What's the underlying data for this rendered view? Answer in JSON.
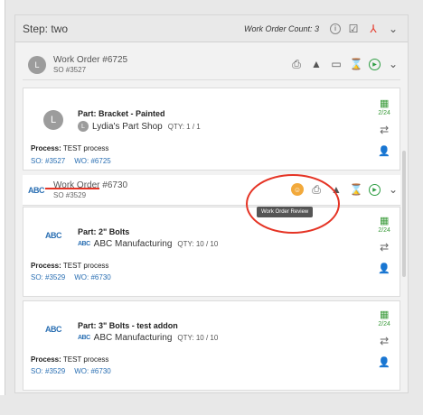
{
  "panel": {
    "step": "Step: two",
    "count": "Work Order Count: 3"
  },
  "work_orders": [
    {
      "title": "Work Order #6725",
      "so": "SO #3527"
    },
    {
      "title": "Work Order #6730",
      "so": "SO #3529"
    }
  ],
  "cards": [
    {
      "part": "Part: Bracket - Painted",
      "shop": "Lydia's Part Shop",
      "qty": "QTY: 1 / 1",
      "process_label": "Process:",
      "process": "TEST process",
      "so": "SO: #3527",
      "wo": "WO: #6725",
      "date": "2/24"
    },
    {
      "part": "Part: 2\" Bolts",
      "shop": "ABC Manufacturing",
      "qty": "QTY: 10 / 10",
      "process_label": "Process:",
      "process": "TEST process",
      "so": "SO: #3529",
      "wo": "WO: #6730",
      "date": "2/24"
    },
    {
      "part": "Part: 3\" Bolts - test addon",
      "shop": "ABC Manufacturing",
      "qty": "QTY: 10 / 10",
      "process_label": "Process:",
      "process": "TEST process",
      "so": "SO: #3529",
      "wo": "WO: #6730",
      "date": "2/24"
    }
  ],
  "tooltip": "Work Order Review",
  "logos": {
    "abc": "ABC",
    "avatar_letter": "L"
  },
  "icons": [
    "info-icon",
    "checklist-icon",
    "split-icon",
    "chevron-down-icon",
    "printer-icon",
    "warning-icon",
    "archive-icon",
    "hourglass-icon",
    "play-icon",
    "review-user-icon",
    "calendar-icon",
    "transfer-icon",
    "user-settings-icon"
  ]
}
